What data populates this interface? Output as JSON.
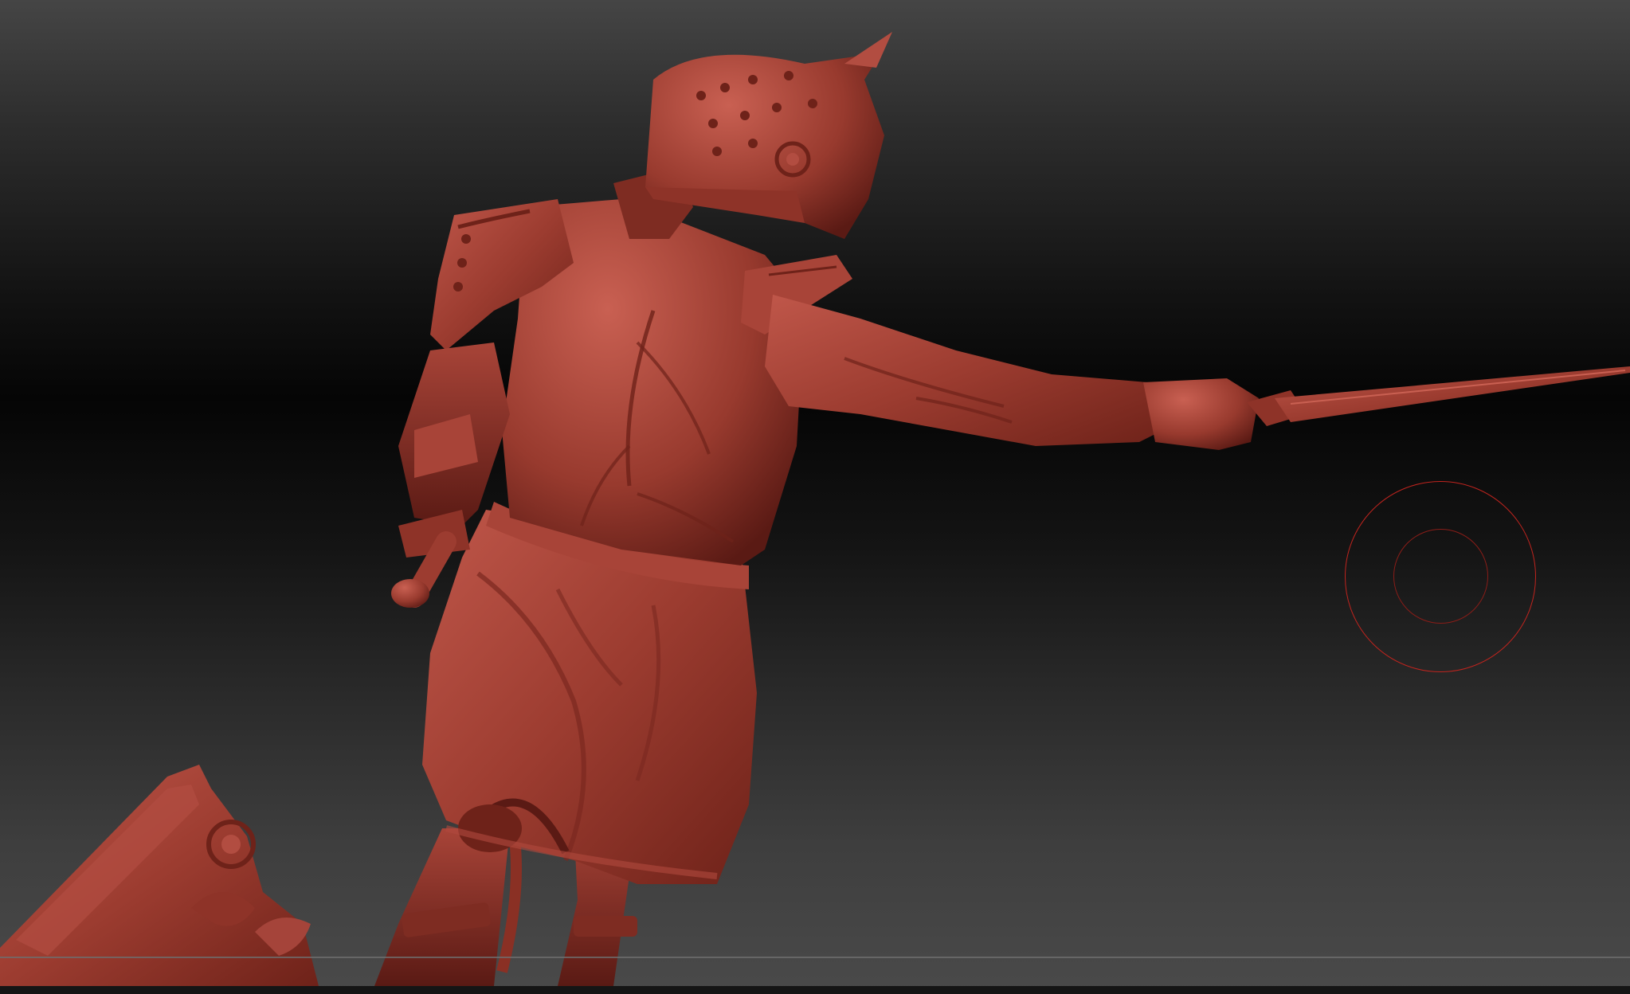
{
  "viewport": {
    "background_top": "#454545",
    "background_mid": "#050505",
    "background_bottom": "#4a4a4a"
  },
  "model": {
    "name": "gladiator-sculpt",
    "material_color": "#9c3c30",
    "material_highlight": "#c0574a",
    "material_shadow": "#5a1a14"
  },
  "brush": {
    "icon": "brush-cursor-icon",
    "color": "#c0241e"
  }
}
